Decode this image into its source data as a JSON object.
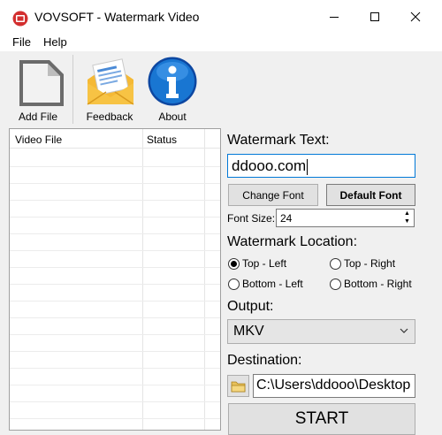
{
  "window": {
    "title": "VOVSOFT - Watermark Video"
  },
  "menu": [
    {
      "label": "File"
    },
    {
      "label": "Help"
    }
  ],
  "toolbar": {
    "add_file_label": "Add File",
    "feedback_label": "Feedback",
    "about_label": "About"
  },
  "file_list": {
    "columns": [
      "Video File",
      "Status"
    ],
    "rows": []
  },
  "watermark": {
    "text_label": "Watermark Text:",
    "text_value": "ddooo.com",
    "change_font_label": "Change Font",
    "default_font_label": "Default Font",
    "font_size_label": "Font Size:",
    "font_size_value": "24"
  },
  "location": {
    "label": "Watermark Location:",
    "options": [
      {
        "label": "Top - Left",
        "selected": true
      },
      {
        "label": "Top - Right",
        "selected": false
      },
      {
        "label": "Bottom - Left",
        "selected": false
      },
      {
        "label": "Bottom - Right",
        "selected": false
      }
    ]
  },
  "output": {
    "label": "Output:",
    "selected": "MKV"
  },
  "destination": {
    "label": "Destination:",
    "value": "C:\\Users\\ddooo\\Desktop"
  },
  "start_label": "START",
  "colors": {
    "focus_border": "#0078d7",
    "button_face": "#e1e1e1",
    "about_icon_blue": "#1565c0",
    "close_red": "#d32f2f"
  },
  "icons": [
    "app-logo-icon",
    "minimize-icon",
    "maximize-icon",
    "close-icon",
    "document-icon",
    "envelope-icon",
    "info-icon",
    "folder-icon",
    "chevron-down-icon"
  ]
}
